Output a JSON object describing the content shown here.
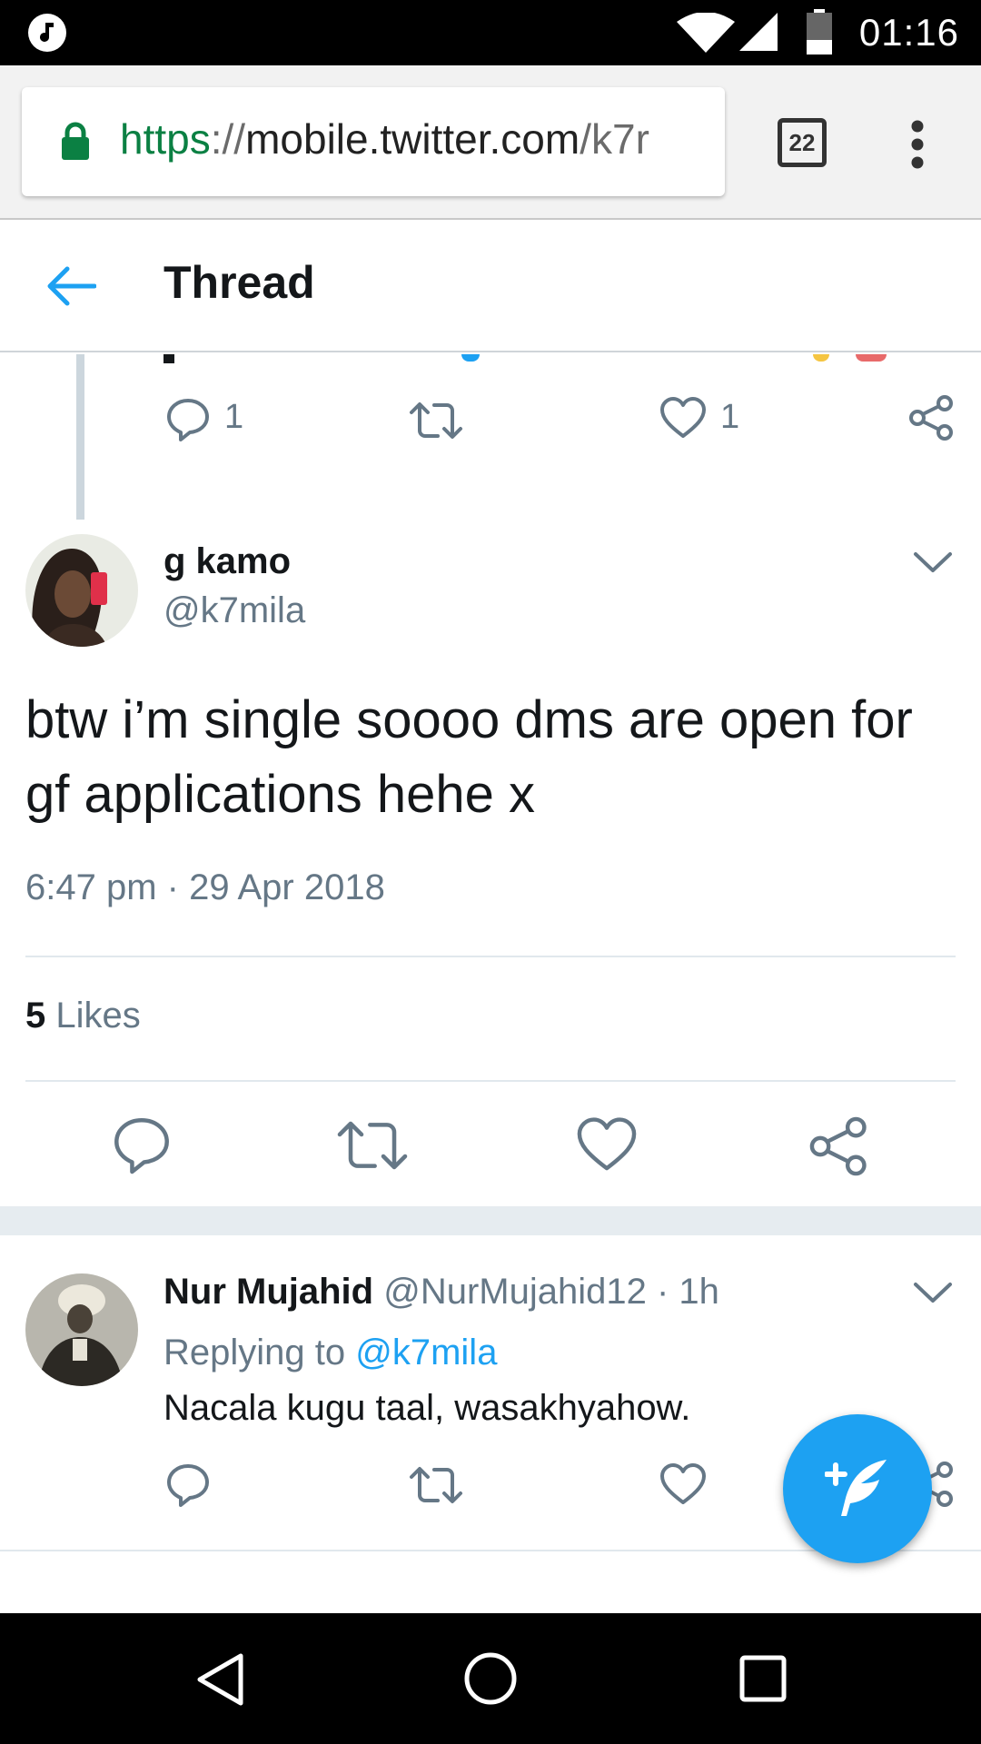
{
  "status_bar": {
    "time": "01:16"
  },
  "browser": {
    "url_scheme": "https",
    "url_separator": "://",
    "url_host": "mobile.twitter.com",
    "url_path": "/k7r",
    "tab_count": "22"
  },
  "header": {
    "title": "Thread"
  },
  "previous_tweet": {
    "reply_count": "1",
    "like_count": "1"
  },
  "main_tweet": {
    "name": "g kamo",
    "handle": "@k7mila",
    "text": "btw i’m single soooo dms are open for gf applications hehe x",
    "timestamp": "6:47 pm · 29 Apr 2018",
    "likes_count": "5",
    "likes_label": "Likes"
  },
  "reply_tweet": {
    "name": "Nur Mujahid",
    "handle_time": "@NurMujahid12 · 1h",
    "replying_label": "Replying to",
    "replying_handle": "@k7mila",
    "text": "Nacala kugu taal, wasakhyahow."
  },
  "colors": {
    "twitter_blue": "#1da1f2",
    "secondary_text": "#657786",
    "primary_text": "#14171a",
    "lock_green": "#0b8043"
  },
  "icons": [
    "music-note-icon",
    "wifi-icon",
    "signal-icon",
    "battery-icon",
    "lock-icon",
    "menu-dots-icon",
    "back-arrow-icon",
    "reply-icon",
    "retweet-icon",
    "like-icon",
    "share-icon",
    "chevron-down-icon",
    "compose-icon",
    "nav-back-icon",
    "nav-home-icon",
    "nav-recents-icon"
  ]
}
